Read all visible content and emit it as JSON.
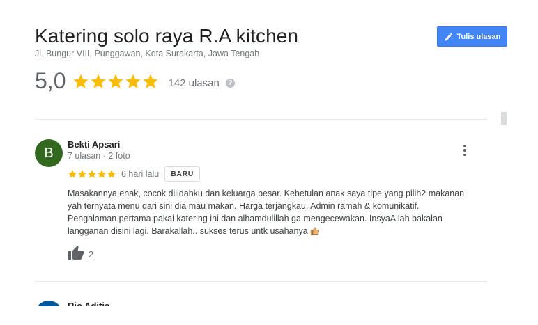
{
  "place": {
    "name": "Katering solo raya R.A kitchen",
    "address": "Jl. Bungur VIII, Punggawan, Kota Surakarta, Jawa Tengah",
    "rating": "5,0",
    "stars": 5,
    "review_count_label": "142 ulasan",
    "help_symbol": "?"
  },
  "write_review": {
    "label": "Tulis ulasan",
    "icon": "pencil-icon"
  },
  "colors": {
    "accent": "#4285f4",
    "star": "#fbbc04",
    "avatar_1": "#33691e",
    "avatar_2": "#01579b"
  },
  "reviews": [
    {
      "avatar_letter": "B",
      "name": "Bekti Apsari",
      "meta": "7 ulasan · 2 foto",
      "stars": 5,
      "date": "6 hari lalu",
      "badge": "BARU",
      "text_lines": [
        "Masakannya enak, cocok dilidahku dan keluarga besar. Kebetulan anak saya tipe yang pilih2 makanan",
        "yah ternyata menu dari sini dia mau makan. Harga terjangkau. Admin ramah & komunikatif.",
        "Pengalaman pertama pakai katering ini dan alhamdulillah ga mengecewakan. InsyaAllah bakalan",
        "langganan disini lagi. Barakallah.. sukses terus untk usahanya"
      ],
      "emoji": "thumbs-up-emoji",
      "like_count": "2"
    },
    {
      "name": "Rio Aditia"
    }
  ]
}
